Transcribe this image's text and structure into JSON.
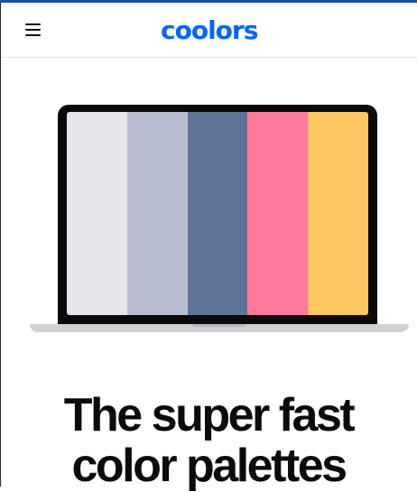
{
  "header": {
    "logo_text": "coolors",
    "logo_color": "#0066ff",
    "menu_icon": "hamburger-menu-icon"
  },
  "hero": {
    "palette": [
      {
        "color": "#e5e6eb"
      },
      {
        "color": "#b8bed0"
      },
      {
        "color": "#5f7397"
      },
      {
        "color": "#ff7a9a"
      },
      {
        "color": "#ffc75f"
      }
    ],
    "title_line_1": "The super fast",
    "title_line_2": "color palettes"
  }
}
